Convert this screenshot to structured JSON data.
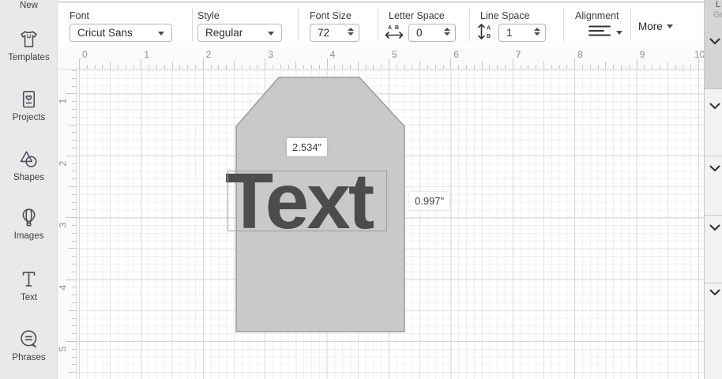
{
  "sidebar": {
    "items": [
      {
        "id": "new",
        "label": "New"
      },
      {
        "id": "templates",
        "label": "Templates"
      },
      {
        "id": "projects",
        "label": "Projects"
      },
      {
        "id": "shapes",
        "label": "Shapes"
      },
      {
        "id": "images",
        "label": "Images"
      },
      {
        "id": "text",
        "label": "Text"
      },
      {
        "id": "phrases",
        "label": "Phrases"
      }
    ]
  },
  "toolbar": {
    "font_label": "Font",
    "font_value": "Cricut Sans",
    "style_label": "Style",
    "style_value": "Regular",
    "font_size_label": "Font Size",
    "font_size_value": "72",
    "letter_space_label": "Letter Space",
    "letter_space_value": "0",
    "line_space_label": "Line Space",
    "line_space_value": "1",
    "alignment_label": "Alignment",
    "more_label": "More"
  },
  "canvas": {
    "ruler_h_numbers": [
      "0",
      "1",
      "2",
      "3",
      "4",
      "5",
      "6",
      "7",
      "8",
      "9",
      "10"
    ],
    "ruler_v_numbers": [
      "1",
      "2",
      "3",
      "4",
      "5"
    ],
    "text_object": "Text",
    "selection_width_label": "2.534\"",
    "selection_height_label": "0.997\""
  },
  "right_panel": {
    "clipped_text_line1": "L",
    "clipped_text_line2": "Gr"
  },
  "colors": {
    "tag_fill": "#c9c9c9",
    "tag_stroke": "#9c9c9c",
    "text_object": "#4c4c4c"
  }
}
